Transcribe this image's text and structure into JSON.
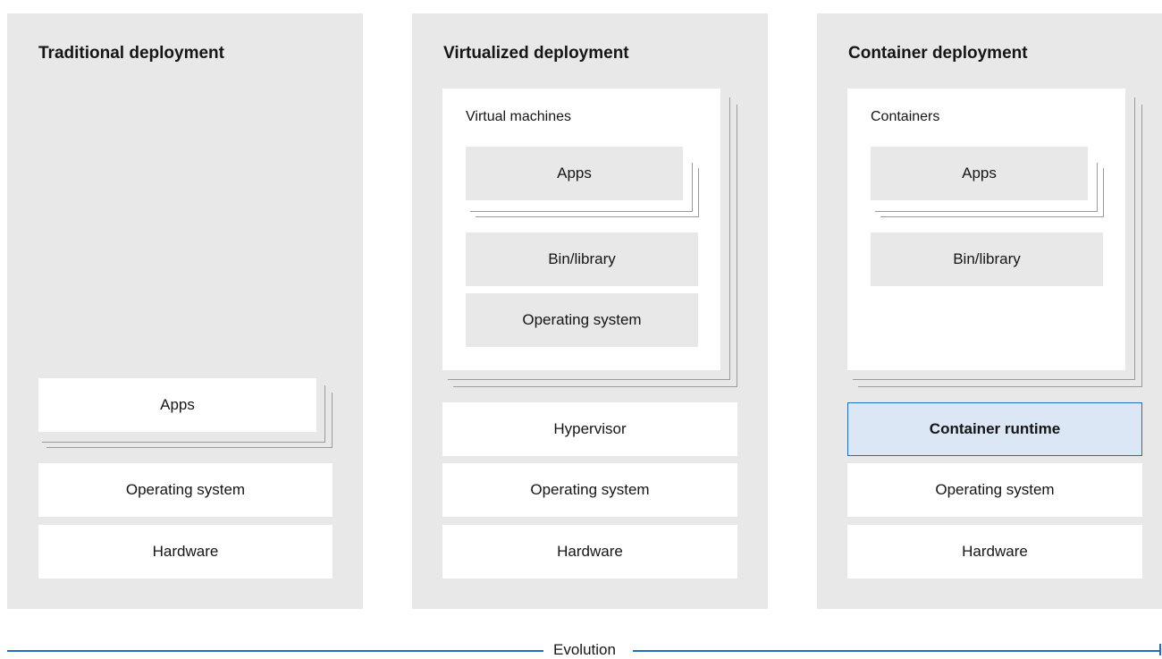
{
  "traditional": {
    "title": "Traditional deployment",
    "apps": "Apps",
    "os": "Operating system",
    "hardware": "Hardware"
  },
  "virtualized": {
    "title": "Virtualized deployment",
    "vm_label": "Virtual machines",
    "apps": "Apps",
    "bin": "Bin/library",
    "guest_os": "Operating system",
    "hypervisor": "Hypervisor",
    "os": "Operating system",
    "hardware": "Hardware"
  },
  "container": {
    "title": "Container deployment",
    "containers_label": "Containers",
    "apps": "Apps",
    "bin": "Bin/library",
    "runtime": "Container runtime",
    "os": "Operating system",
    "hardware": "Hardware"
  },
  "axis": {
    "label": "Evolution"
  },
  "colors": {
    "accent": "#1f6fbe",
    "runtime_fill": "#dbe7f5",
    "panel": "#e8e8e8"
  }
}
